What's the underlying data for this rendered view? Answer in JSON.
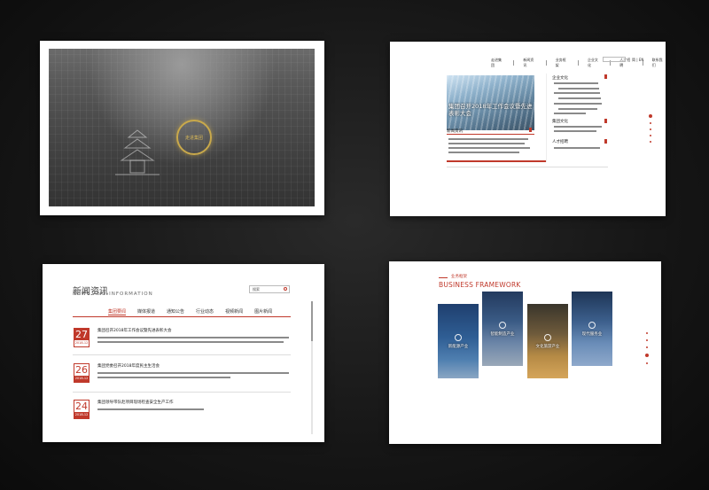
{
  "intro": {
    "center_label": "走进集团"
  },
  "home": {
    "nav": [
      "走进集团",
      "新闻资讯",
      "业务框架",
      "企业文化",
      "人才招聘",
      "联系我们"
    ],
    "lang": "简 | EN",
    "hero_caption": "集团召开2018年工作会议暨先进表彰大会",
    "news_label": "新闻资讯",
    "culture_label": "企业文化",
    "culture2_label": "集团文化",
    "talent_label": "人才招聘",
    "more_label": "更多 +"
  },
  "news": {
    "title_cn": "新闻资讯",
    "title_en": "NEWS AND INFORMATION",
    "search_placeholder": "搜索",
    "tabs": [
      "集团要闻",
      "媒体报道",
      "通知公告",
      "行业动态",
      "视频新闻",
      "图片新闻"
    ],
    "items": [
      {
        "day": "27",
        "ym": "2018-12",
        "title": "集团召开2018年工作会议暨先进表彰大会"
      },
      {
        "day": "26",
        "ym": "2018-12",
        "title": "集团党委召开2018年度民主生活会"
      },
      {
        "day": "24",
        "ym": "2018-12",
        "title": "集团领导带队赴项目现场检查安全生产工作"
      }
    ]
  },
  "business": {
    "small_label": "业务框架",
    "title": "BUSINESS FRAMEWORK",
    "panels": [
      "新能源产业",
      "智能制造产业",
      "文化旅游产业",
      "现代服务业"
    ]
  },
  "colors": {
    "accent": "#c0392b",
    "gold": "#c9a94b"
  }
}
